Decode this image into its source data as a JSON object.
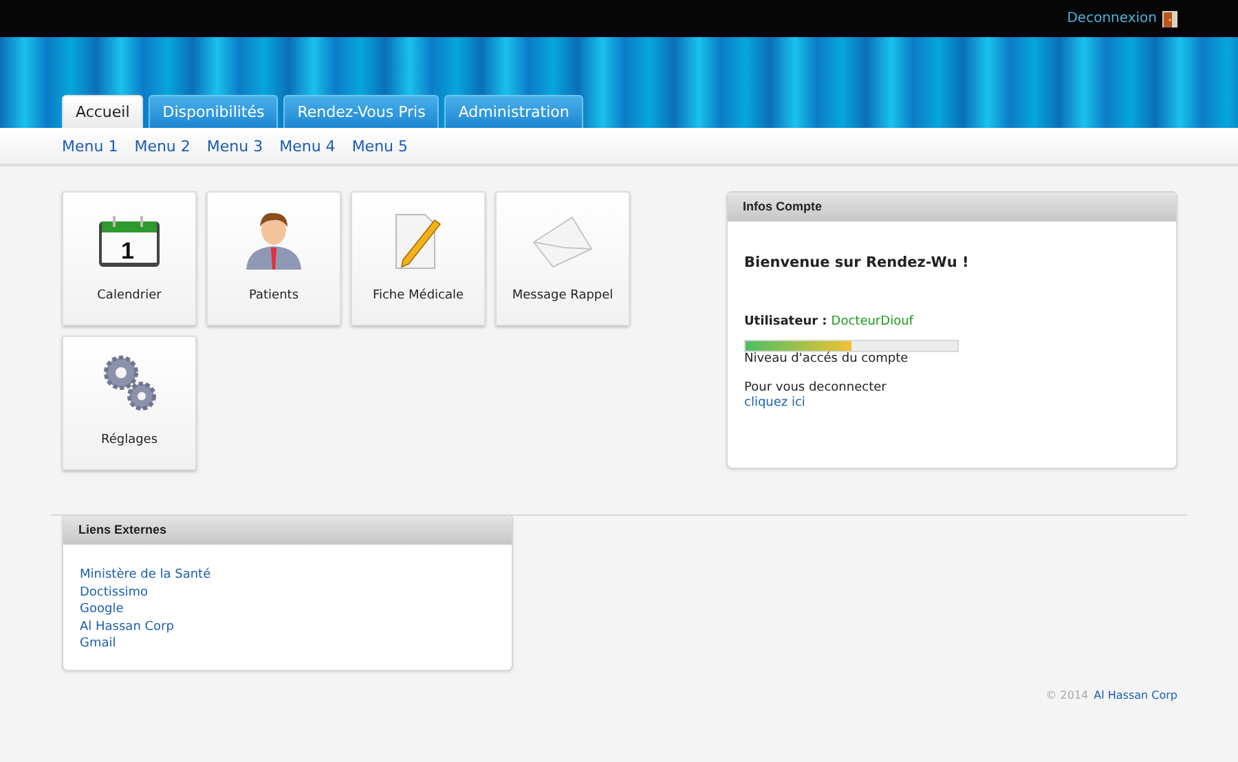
{
  "top_bar": {
    "logout_link": "Deconnexion"
  },
  "tabs": [
    {
      "label": "Accueil",
      "selected": true
    },
    {
      "label": "Disponibilités",
      "selected": false
    },
    {
      "label": "Rendez-Vous Pris",
      "selected": false
    },
    {
      "label": "Administration",
      "selected": false
    }
  ],
  "submenu": [
    "Menu 1",
    "Menu 2",
    "Menu 3",
    "Menu 4",
    "Menu 5"
  ],
  "tiles": [
    {
      "kind": "calendar",
      "label": "Calendrier",
      "day": "1"
    },
    {
      "kind": "person",
      "label": "Patients"
    },
    {
      "kind": "document",
      "label": "Fiche Médicale"
    },
    {
      "kind": "envelope",
      "label": "Message Rappel"
    },
    {
      "kind": "gears",
      "label": "Réglages"
    }
  ],
  "account_panel": {
    "title": "Infos Compte",
    "welcome": "Bienvenue sur Rendez-Wu !",
    "user_label": "Utilisateur :",
    "user_name": "DocteurDiouf",
    "access_level": {
      "level": 0.5
    },
    "access_caption": "Niveau d'accés du compte",
    "logout_text": "Pour vous deconnecter",
    "logout_link": "cliquez ici"
  },
  "links_panel": {
    "title": "Liens Externes",
    "links": [
      "Ministère de la Santé",
      "Doctissimo",
      "Google",
      "Al Hassan Corp",
      "Gmail"
    ]
  },
  "footer": {
    "copyright": "© 2014",
    "link": "Al Hassan Corp"
  }
}
